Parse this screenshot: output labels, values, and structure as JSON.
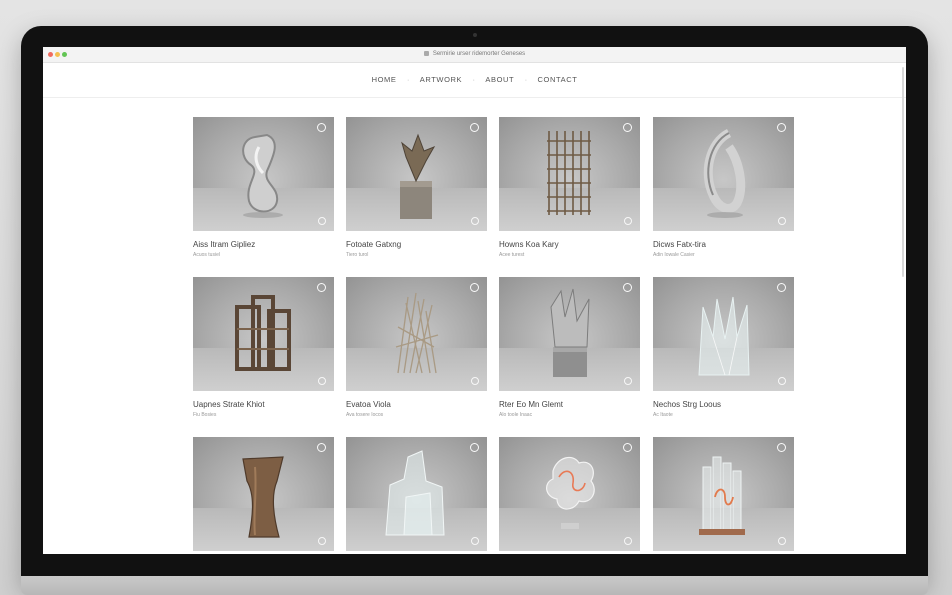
{
  "browser": {
    "url": "Sermirie urser ridemorter Geneses"
  },
  "nav": {
    "items": [
      "HOME",
      "ARTWORK",
      "ABOUT",
      "CONTACT"
    ]
  },
  "gallery": {
    "items": [
      {
        "title": "Aiss Itram Gipliez",
        "subtitle": "Acuos tusiel",
        "art": "twist-silver"
      },
      {
        "title": "Fotoate Gatxng",
        "subtitle": "Tiero turol",
        "art": "bird-pedestal"
      },
      {
        "title": "Howns Koa Kary",
        "subtitle": "Acee turest",
        "art": "wood-tower"
      },
      {
        "title": "Dicws Fatx-tira",
        "subtitle": "Adin Iowale Casier",
        "art": "silver-loop"
      },
      {
        "title": "Uapnes Strate Khiot",
        "subtitle": "Fiu Bosies",
        "art": "wood-frames"
      },
      {
        "title": "Evatoa Viola",
        "subtitle": "Ava tosere Iocos",
        "art": "dry-sticks"
      },
      {
        "title": "Rter Eo Mn Glemt",
        "subtitle": "Alo toole Inaac",
        "art": "stone-pedestal"
      },
      {
        "title": "Nechos Strg Loous",
        "subtitle": "Ac Itaote",
        "art": "glass-crystals"
      },
      {
        "title": "",
        "subtitle": "",
        "art": "wood-vase"
      },
      {
        "title": "",
        "subtitle": "",
        "art": "glass-shards"
      },
      {
        "title": "",
        "subtitle": "",
        "art": "glass-neon"
      },
      {
        "title": "",
        "subtitle": "",
        "art": "glass-copper"
      }
    ]
  }
}
